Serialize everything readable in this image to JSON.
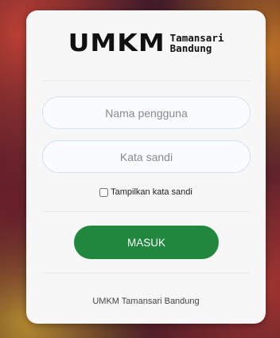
{
  "logo": {
    "main": "UMKM",
    "sub_line1": "Tamansari",
    "sub_line2": "Bandung"
  },
  "form": {
    "username_placeholder": "Nama pengguna",
    "password_placeholder": "Kata sandi",
    "show_password_label": "Tampilkan kata sandi",
    "submit_label": "MASUK"
  },
  "footer": {
    "text": "UMKM Tamansari Bandung"
  },
  "colors": {
    "accent": "#21873f",
    "card": "#f7f7f7",
    "input_border": "#d6e1f0"
  }
}
